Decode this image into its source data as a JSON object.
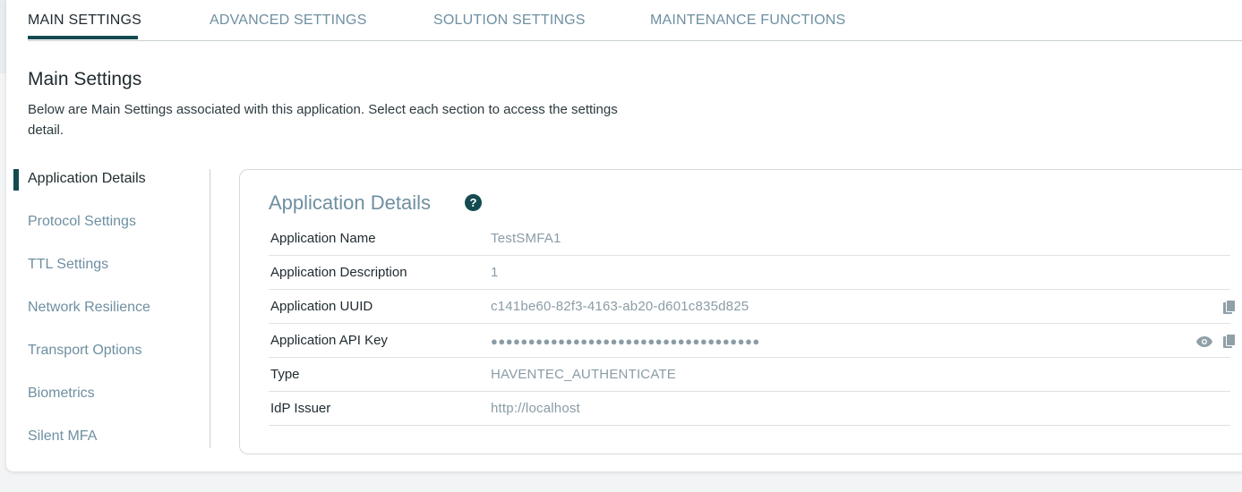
{
  "tabs": [
    {
      "label": "MAIN SETTINGS",
      "active": true
    },
    {
      "label": "ADVANCED SETTINGS"
    },
    {
      "label": "SOLUTION SETTINGS"
    },
    {
      "label": "MAINTENANCE FUNCTIONS"
    }
  ],
  "page": {
    "title": "Main Settings",
    "description": "Below are Main Settings associated with this application. Select each section to access the settings detail."
  },
  "side_nav": {
    "items": [
      {
        "label": "Application Details",
        "active": true
      },
      {
        "label": "Protocol Settings"
      },
      {
        "label": "TTL Settings"
      },
      {
        "label": "Network Resilience"
      },
      {
        "label": "Transport Options"
      },
      {
        "label": "Biometrics"
      },
      {
        "label": "Silent MFA"
      }
    ]
  },
  "details": {
    "title": "Application Details",
    "help_symbol": "?",
    "rows": [
      {
        "label": "Application Name",
        "value": "TestSMFA1"
      },
      {
        "label": "Application Description",
        "value": "1"
      },
      {
        "label": "Application UUID",
        "value": "c141be60-82f3-4163-ab20-d601c835d825",
        "icons": [
          "copy-icon"
        ]
      },
      {
        "label": "Application API Key",
        "value": "●●●●●●●●●●●●●●●●●●●●●●●●●●●●●●●●●●●●",
        "icons": [
          "eye-icon",
          "copy-icon"
        ]
      },
      {
        "label": "Type",
        "value": "HAVENTEC_AUTHENTICATE"
      },
      {
        "label": "IdP Issuer",
        "value": "http://localhost"
      }
    ]
  },
  "colors": {
    "accent": "#134b50",
    "muted_text": "#6e8fa1",
    "value_text": "#8a9ca6"
  }
}
